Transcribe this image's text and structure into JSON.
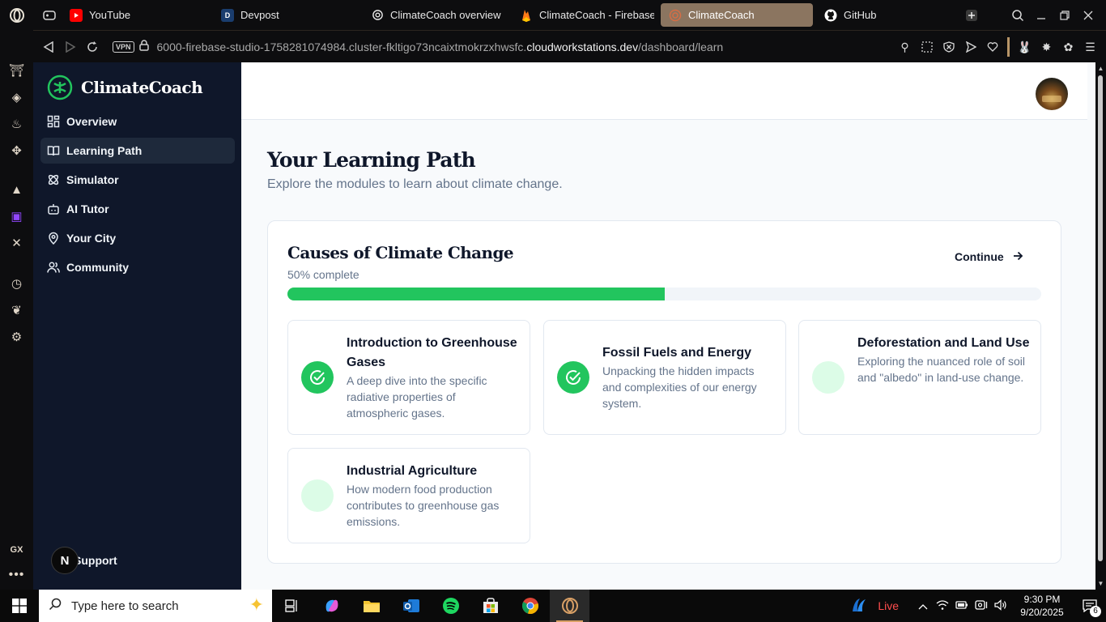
{
  "browser": {
    "tabs": [
      {
        "label": "YouTube",
        "favicon": "youtube-icon",
        "active": false
      },
      {
        "label": "Devpost",
        "favicon": "devpost-icon",
        "active": false
      },
      {
        "label": "ClimateCoach overview",
        "favicon": "openai-icon",
        "active": false
      },
      {
        "label": "ClimateCoach - Firebase",
        "favicon": "firebase-icon",
        "active": false
      },
      {
        "label": "ClimateCoach",
        "favicon": "climatecoach-icon",
        "active": true
      },
      {
        "label": "GitHub",
        "favicon": "github-icon",
        "active": false
      }
    ],
    "vpn_label": "VPN",
    "url_prefix": "6000-firebase-studio-1758281074984.cluster-fkltigo73ncaixtmokrzxhwsfc.",
    "url_domain": "cloudworkstations.dev",
    "url_path": "/dashboard/learn",
    "rail_gx_label": "GX"
  },
  "app": {
    "brand": "ClimateCoach",
    "brand_color": "#22c55e",
    "nav": [
      {
        "label": "Overview",
        "icon": "grid-icon",
        "active": false
      },
      {
        "label": "Learning Path",
        "icon": "book-open-icon",
        "active": true
      },
      {
        "label": "Simulator",
        "icon": "atom-icon",
        "active": false
      },
      {
        "label": "AI Tutor",
        "icon": "bot-icon",
        "active": false
      },
      {
        "label": "Your City",
        "icon": "map-pin-icon",
        "active": false
      },
      {
        "label": "Community",
        "icon": "users-icon",
        "active": false
      }
    ],
    "support_label": "Support",
    "support_badge": "N"
  },
  "main": {
    "title": "Your Learning Path",
    "subtitle": "Explore the modules to learn about climate change.",
    "module": {
      "title": "Causes of Climate Change",
      "progress_text": "50% complete",
      "progress_fraction": 0.5,
      "continue_label": "Continue",
      "lessons": [
        {
          "title": "Introduction to Greenhouse Gases",
          "description": "A deep dive into the specific radiative properties of atmospheric gases.",
          "completed": true
        },
        {
          "title": "Fossil Fuels and Energy",
          "description": "Unpacking the hidden impacts and complexities of our energy system.",
          "completed": true
        },
        {
          "title": "Deforestation and Land Use",
          "description": "Exploring the nuanced role of soil and \"albedo\" in land-use change.",
          "completed": false
        },
        {
          "title": "Industrial Agriculture",
          "description": "How modern food production contributes to greenhouse gas emissions.",
          "completed": false
        }
      ]
    }
  },
  "taskbar": {
    "search_placeholder": "Type here to search",
    "live_label": "Live",
    "time": "9:30 PM",
    "date": "9/20/2025",
    "notification_count": "6"
  }
}
